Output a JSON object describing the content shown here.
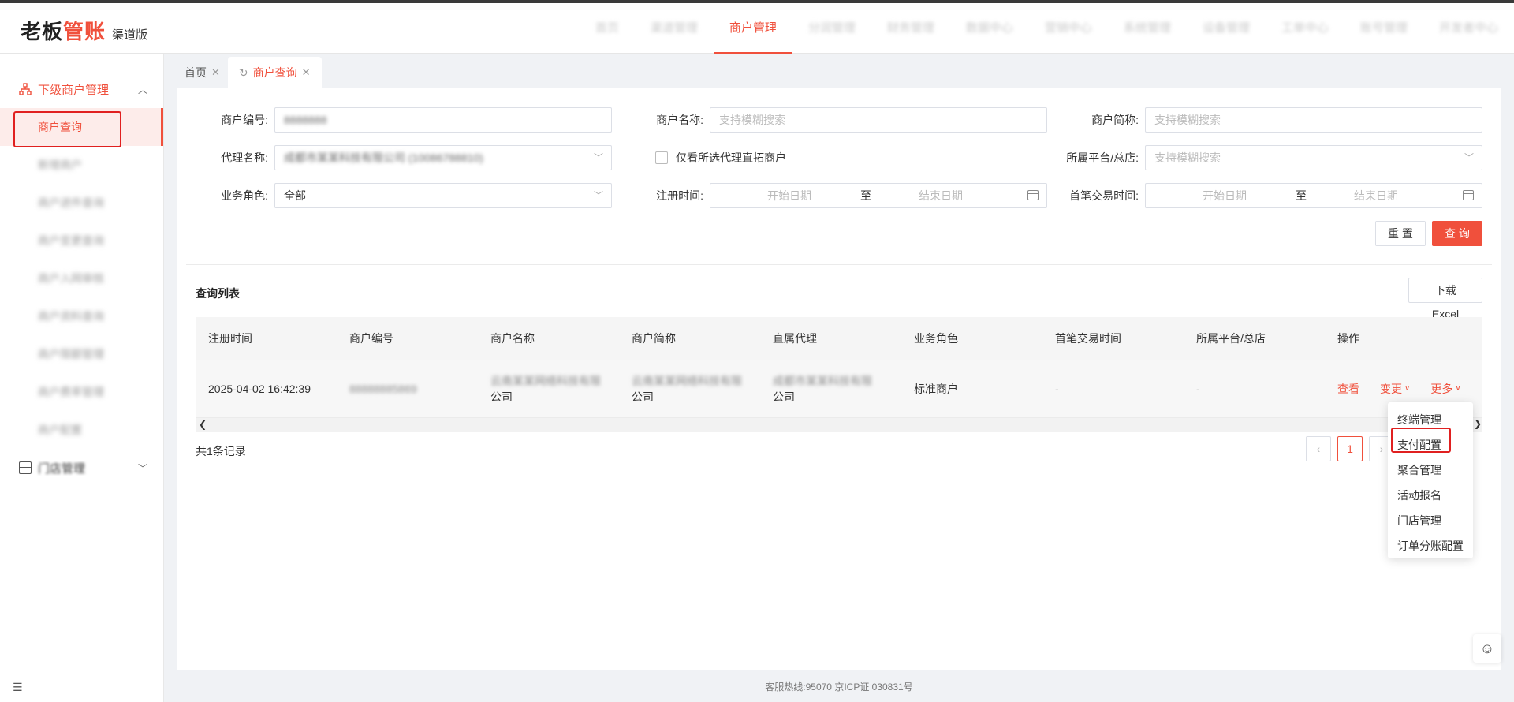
{
  "header": {
    "logo_prefix": "老板",
    "logo_accent": "管账",
    "logo_sub": "渠道版",
    "nav": [
      {
        "label": "首页",
        "blur": true
      },
      {
        "label": "渠道管理",
        "blur": true
      },
      {
        "label": "商户管理",
        "blur": false,
        "active": true
      },
      {
        "label": "分润管理",
        "blur": true
      },
      {
        "label": "财务管理",
        "blur": true
      },
      {
        "label": "数据中心",
        "blur": true
      },
      {
        "label": "营销中心",
        "blur": true
      },
      {
        "label": "系统管理",
        "blur": true
      },
      {
        "label": "设备管理",
        "blur": true
      },
      {
        "label": "工单中心",
        "blur": true
      },
      {
        "label": "账号管理",
        "blur": true
      },
      {
        "label": "开发者中心",
        "blur": true
      }
    ]
  },
  "sidebar": {
    "group1": "下级商户管理",
    "items": [
      {
        "label": "商户查询",
        "active": true
      },
      {
        "label": "新增商户",
        "blur": true
      },
      {
        "label": "商户进件查询",
        "blur": true
      },
      {
        "label": "商户变更查询",
        "blur": true
      },
      {
        "label": "商户入网审核",
        "blur": true
      },
      {
        "label": "商户资料查询",
        "blur": true
      },
      {
        "label": "商户限额管理",
        "blur": true
      },
      {
        "label": "商户费率管理",
        "blur": true
      },
      {
        "label": "商户配置",
        "blur": true
      }
    ],
    "group2": "门店管理"
  },
  "tabs": [
    {
      "label": "首页"
    },
    {
      "label": "商户查询",
      "active": true
    }
  ],
  "form": {
    "merchant_no_label": "商户编号:",
    "merchant_no_value": "8888888",
    "merchant_name_label": "商户名称:",
    "merchant_name_placeholder": "支持模糊搜索",
    "merchant_short_label": "商户简称:",
    "merchant_short_placeholder": "支持模糊搜索",
    "agent_label": "代理名称:",
    "agent_value": "成都市某某科技有限公司 (10086788810)",
    "only_direct_label": "仅看所选代理直拓商户",
    "platform_label": "所属平台/总店:",
    "platform_placeholder": "支持模糊搜索",
    "role_label": "业务角色:",
    "role_value": "全部",
    "reg_time_label": "注册时间:",
    "first_trade_label": "首笔交易时间:",
    "start_date": "开始日期",
    "end_date": "结束日期",
    "to": "至",
    "reset_button": "重 置",
    "query_button": "查 询"
  },
  "list": {
    "title": "查询列表",
    "download_button": "下载Excel",
    "columns": [
      "注册时间",
      "商户编号",
      "商户名称",
      "商户简称",
      "直属代理",
      "业务角色",
      "首笔交易时间",
      "所属平台/总店",
      "操作"
    ],
    "rows": [
      {
        "reg_time": "2025-04-02 16:42:39",
        "merchant_no": "88888885869",
        "merchant_name_line1": "云南某某网络科技有限",
        "merchant_name_line2": "公司",
        "short_name_line1": "云南某某网络科技有限",
        "short_name_line2": "公司",
        "agent_line1": "成都市某某科技有限",
        "agent_line2": "公司",
        "role": "标准商户",
        "first_trade": "-",
        "platform": "-",
        "op_view": "查看",
        "op_change": "变更",
        "op_more": "更多"
      }
    ],
    "total": "共1条记录",
    "page_current": "1"
  },
  "more_menu": [
    "终端管理",
    "支付配置",
    "聚合管理",
    "活动报名",
    "门店管理",
    "订单分账配置"
  ],
  "footer": "客服热线:95070 京ICP证 030831号"
}
